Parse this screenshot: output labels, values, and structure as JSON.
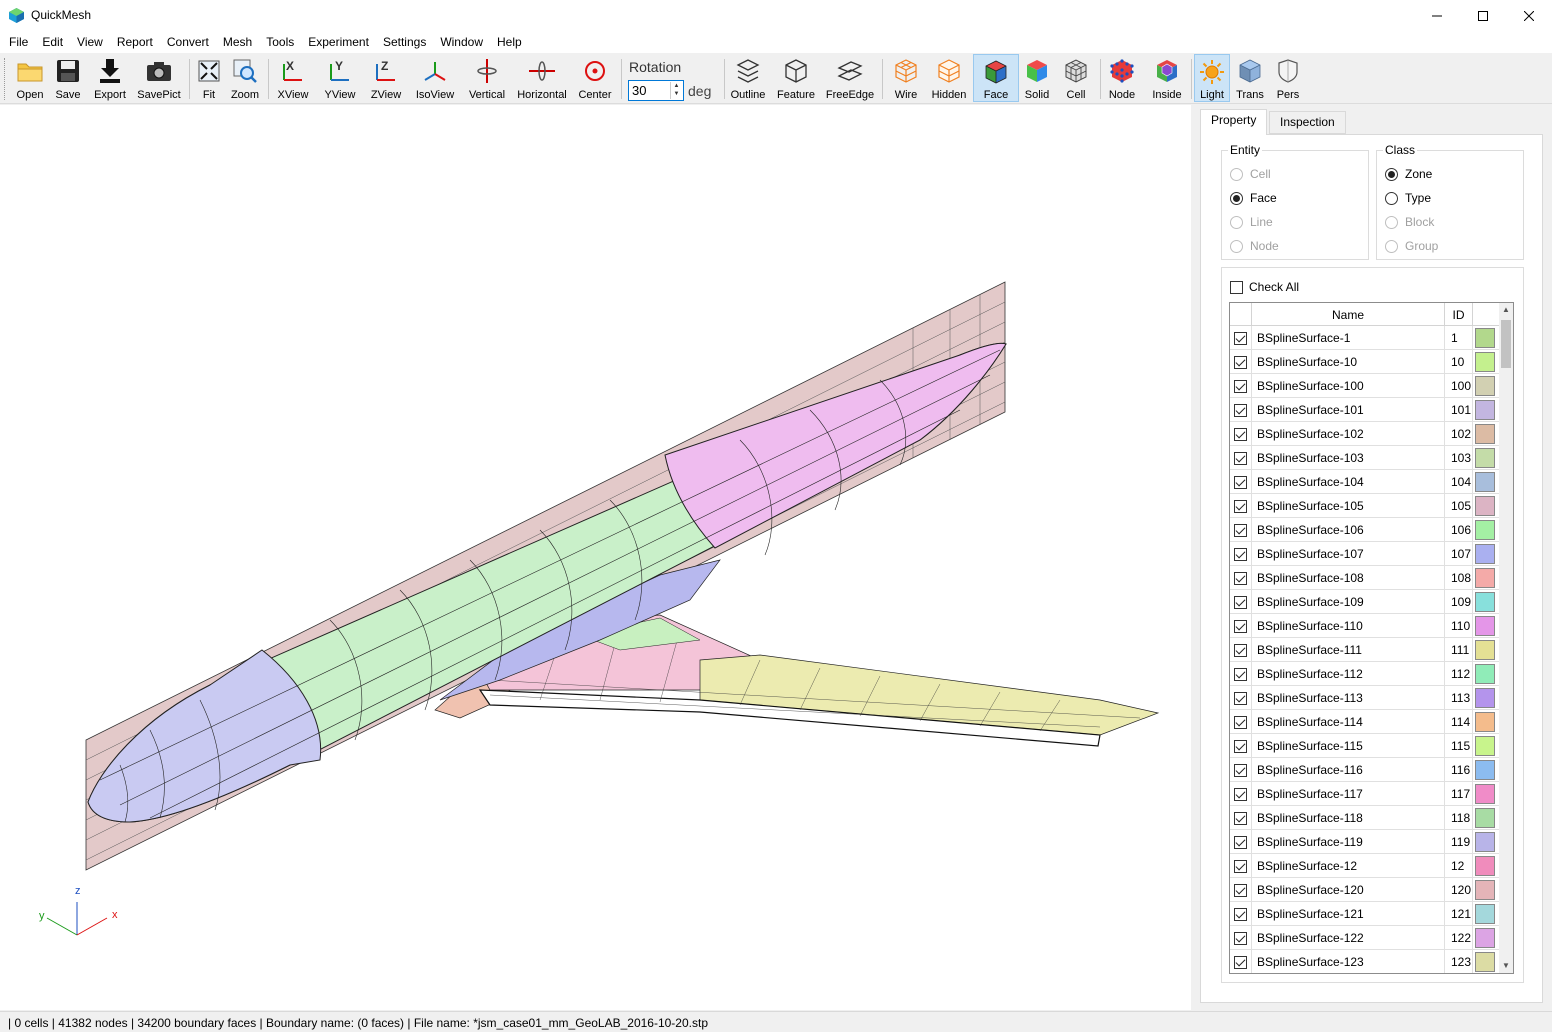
{
  "window": {
    "title": "QuickMesh"
  },
  "menu": [
    "File",
    "Edit",
    "View",
    "Report",
    "Convert",
    "Mesh",
    "Tools",
    "Experiment",
    "Settings",
    "Window",
    "Help"
  ],
  "toolbar": {
    "buttons": [
      {
        "label": "Open",
        "icon": "folder-icon"
      },
      {
        "label": "Save",
        "icon": "floppy-icon"
      },
      {
        "label": "Export",
        "icon": "export-arrow-icon"
      },
      {
        "label": "SavePict",
        "icon": "camera-icon"
      },
      {
        "label": "Fit",
        "icon": "fit-icon"
      },
      {
        "label": "Zoom",
        "icon": "zoom-icon"
      },
      {
        "label": "XView",
        "icon": "x-view-icon"
      },
      {
        "label": "YView",
        "icon": "y-view-icon"
      },
      {
        "label": "ZView",
        "icon": "z-view-icon"
      },
      {
        "label": "IsoView",
        "icon": "iso-view-icon"
      },
      {
        "label": "Vertical",
        "icon": "vertical-rotate-icon"
      },
      {
        "label": "Horizontal",
        "icon": "horizontal-rotate-icon"
      },
      {
        "label": "Center",
        "icon": "center-icon"
      },
      {
        "label": "Outline",
        "icon": "outline-icon"
      },
      {
        "label": "Feature",
        "icon": "feature-icon"
      },
      {
        "label": "FreeEdge",
        "icon": "free-edge-icon"
      },
      {
        "label": "Wire",
        "icon": "wire-cube-icon"
      },
      {
        "label": "Hidden",
        "icon": "hidden-cube-icon"
      },
      {
        "label": "Face",
        "icon": "face-cube-icon"
      },
      {
        "label": "Solid",
        "icon": "solid-cube-icon"
      },
      {
        "label": "Cell",
        "icon": "cell-cube-icon"
      },
      {
        "label": "Node",
        "icon": "node-cube-icon"
      },
      {
        "label": "Inside",
        "icon": "inside-cube-icon"
      },
      {
        "label": "Light",
        "icon": "light-sun-icon"
      },
      {
        "label": "Trans",
        "icon": "trans-cube-icon"
      },
      {
        "label": "Pers",
        "icon": "pers-shield-icon"
      }
    ],
    "rotation": {
      "label": "Rotation",
      "value": "30",
      "unit": "deg"
    }
  },
  "axes": {
    "z": "z",
    "y": "y",
    "x": "x"
  },
  "panel": {
    "tabs": [
      "Property",
      "Inspection"
    ],
    "entity": {
      "title": "Entity",
      "options": [
        "Cell",
        "Face",
        "Line",
        "Node"
      ],
      "selected": "Face"
    },
    "class": {
      "title": "Class",
      "options": [
        "Zone",
        "Type",
        "Block",
        "Group"
      ],
      "selected": "Zone"
    },
    "check_all": "Check All",
    "table": {
      "headers": [
        "Name",
        "ID"
      ],
      "rows": [
        {
          "name": "BSplineSurface-1",
          "id": "1",
          "color": "#b2d88c"
        },
        {
          "name": "BSplineSurface-10",
          "id": "10",
          "color": "#c4f08e"
        },
        {
          "name": "BSplineSurface-100",
          "id": "100",
          "color": "#d2d0b2"
        },
        {
          "name": "BSplineSurface-101",
          "id": "101",
          "color": "#c3b6e0"
        },
        {
          "name": "BSplineSurface-102",
          "id": "102",
          "color": "#dcbba4"
        },
        {
          "name": "BSplineSurface-103",
          "id": "103",
          "color": "#c4dca8"
        },
        {
          "name": "BSplineSurface-104",
          "id": "104",
          "color": "#a8bedc"
        },
        {
          "name": "BSplineSurface-105",
          "id": "105",
          "color": "#dcb4c4"
        },
        {
          "name": "BSplineSurface-106",
          "id": "106",
          "color": "#a4f0a4"
        },
        {
          "name": "BSplineSurface-107",
          "id": "107",
          "color": "#aab0f0"
        },
        {
          "name": "BSplineSurface-108",
          "id": "108",
          "color": "#f4aaa8"
        },
        {
          "name": "BSplineSurface-109",
          "id": "109",
          "color": "#88e0dc"
        },
        {
          "name": "BSplineSurface-110",
          "id": "110",
          "color": "#e496e8"
        },
        {
          "name": "BSplineSurface-111",
          "id": "111",
          "color": "#e4e094"
        },
        {
          "name": "BSplineSurface-112",
          "id": "112",
          "color": "#90ecb8"
        },
        {
          "name": "BSplineSurface-113",
          "id": "113",
          "color": "#b494ec"
        },
        {
          "name": "BSplineSurface-114",
          "id": "114",
          "color": "#f4bc8c"
        },
        {
          "name": "BSplineSurface-115",
          "id": "115",
          "color": "#c8f48c"
        },
        {
          "name": "BSplineSurface-116",
          "id": "116",
          "color": "#8cbcf0"
        },
        {
          "name": "BSplineSurface-117",
          "id": "117",
          "color": "#f08cc8"
        },
        {
          "name": "BSplineSurface-118",
          "id": "118",
          "color": "#a8dca4"
        },
        {
          "name": "BSplineSurface-119",
          "id": "119",
          "color": "#b8b4e8"
        },
        {
          "name": "BSplineSurface-12",
          "id": "12",
          "color": "#f08cbc"
        },
        {
          "name": "BSplineSurface-120",
          "id": "120",
          "color": "#e4b4b8"
        },
        {
          "name": "BSplineSurface-121",
          "id": "121",
          "color": "#a4d8dc"
        },
        {
          "name": "BSplineSurface-122",
          "id": "122",
          "color": "#dca4e4"
        },
        {
          "name": "BSplineSurface-123",
          "id": "123",
          "color": "#dcdca4"
        }
      ]
    }
  },
  "status": {
    "text": "| 0 cells | 41382 nodes | 34200 boundary faces |  Boundary name:  (0 faces) | File name: *jsm_case01_mm_GeoLAB_2016-10-20.stp"
  }
}
